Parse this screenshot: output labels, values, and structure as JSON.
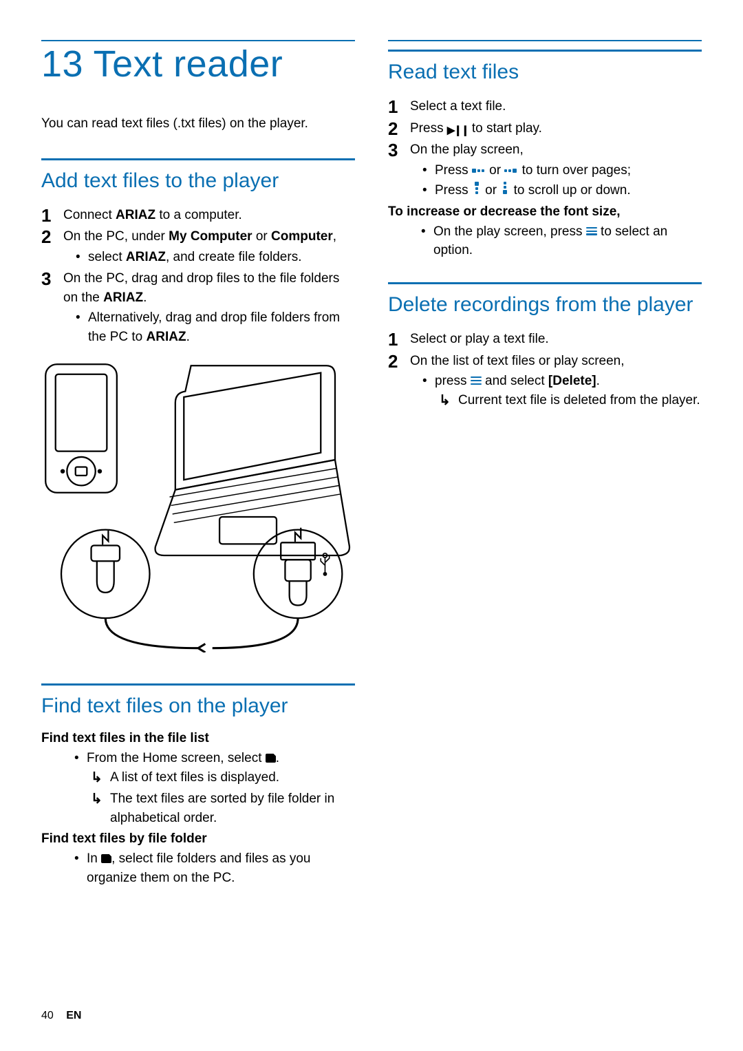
{
  "chapter": {
    "number": "13",
    "title": "Text reader"
  },
  "intro": "You can read text files (.txt files) on the player.",
  "left": {
    "sec1": {
      "title": "Add text files to the player",
      "s1": {
        "pre": "Connect ",
        "b": "ARIAZ",
        "post": " to a computer."
      },
      "s2": {
        "pre": "On the PC, under ",
        "b1": "My Computer",
        "mid": " or ",
        "b2": "Computer",
        "post": ","
      },
      "s2a": {
        "pre": "select ",
        "b": "ARIAZ",
        "post": ", and create file folders."
      },
      "s3": {
        "pre": "On the PC, drag and drop files to the file folders on the ",
        "b": "ARIAZ",
        "post": "."
      },
      "s3a": {
        "pre": "Alternatively, drag and drop file folders from the PC to ",
        "b": "ARIAZ",
        "post": "."
      }
    },
    "sec2": {
      "title": "Find text files on the player",
      "sub1": "Find text files in the file list",
      "b1": {
        "pre": "From the Home screen, select ",
        "post": "."
      },
      "r1": "A list of text files is displayed.",
      "r2": "The text files are sorted by file folder in alphabetical order.",
      "sub2": "Find text files by file folder",
      "b2": {
        "pre": "In ",
        "post": ", select file folders and files as you organize them on the PC."
      }
    }
  },
  "right": {
    "sec1": {
      "title": "Read text files",
      "s1": "Select a text file.",
      "s2": {
        "pre": "Press ",
        "post": " to start play."
      },
      "s3": "On the play screen,",
      "b1": {
        "pre": "Press ",
        "mid": " or ",
        "post": " to turn over pages;"
      },
      "b2": {
        "pre": "Press ",
        "mid": " or ",
        "post": " to scroll up or down."
      },
      "sub": "To increase or decrease the font size,",
      "b3": {
        "pre": "On the play screen, press ",
        "post": " to select an option."
      }
    },
    "sec2": {
      "title": "Delete recordings from the player",
      "s1": "Select or play a text file.",
      "s2": "On the list of text files or play screen,",
      "b1": {
        "pre": "press ",
        "mid": " and select ",
        "b": "[Delete]",
        "post": "."
      },
      "r1": "Current text file is deleted from the player."
    }
  },
  "footer": {
    "page": "40",
    "lang": "EN"
  }
}
